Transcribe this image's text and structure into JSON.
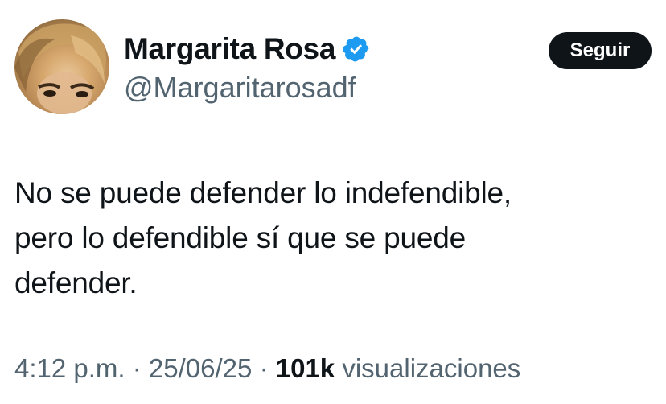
{
  "author": {
    "display_name": "Margarita Rosa",
    "handle": "@Margaritarosadf",
    "verified_icon": "verified-badge-icon",
    "verified_color": "#1d9bf0"
  },
  "follow_label": "Seguir",
  "tweet": {
    "lines": [
      "No se puede defender lo indefendible,",
      "pero lo defendible sí que se puede",
      "defender."
    ]
  },
  "meta": {
    "time": "4:12 p.m.",
    "separator": "·",
    "date": "25/06/25",
    "views_count": "101k",
    "views_label": "visualizaciones"
  },
  "colors": {
    "text_primary": "#0f1419",
    "text_secondary": "#536471",
    "button_bg": "#0f1419",
    "button_text": "#ffffff"
  }
}
